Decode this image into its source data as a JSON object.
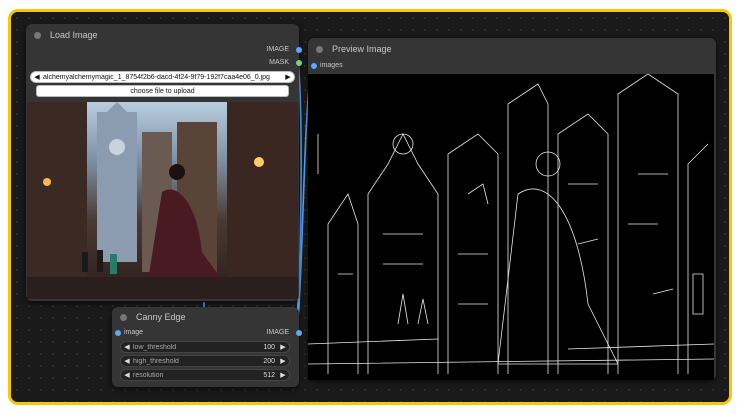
{
  "load_image": {
    "title": "Load Image",
    "outputs": [
      "IMAGE",
      "MASK"
    ],
    "image_value": "alchemyalchemymagic_1_8754f2b6-dacd-4f24-9f79-192f7caa4e06_0.jpg",
    "upload_label": "choose file to upload"
  },
  "preview_image": {
    "title": "Preview Image",
    "input_label": "images"
  },
  "canny_edge": {
    "title": "Canny Edge",
    "input_label": "image",
    "output_label": "IMAGE",
    "widgets": [
      {
        "label": "low_threshold",
        "value": "100"
      },
      {
        "label": "high_threshold",
        "value": "200"
      },
      {
        "label": "resolution",
        "value": "512"
      }
    ]
  },
  "colors": {
    "frame": "#f6c800",
    "link": "#5aa8ff",
    "node": "#353535"
  },
  "icons": {
    "left": "◀",
    "right": "▶"
  }
}
